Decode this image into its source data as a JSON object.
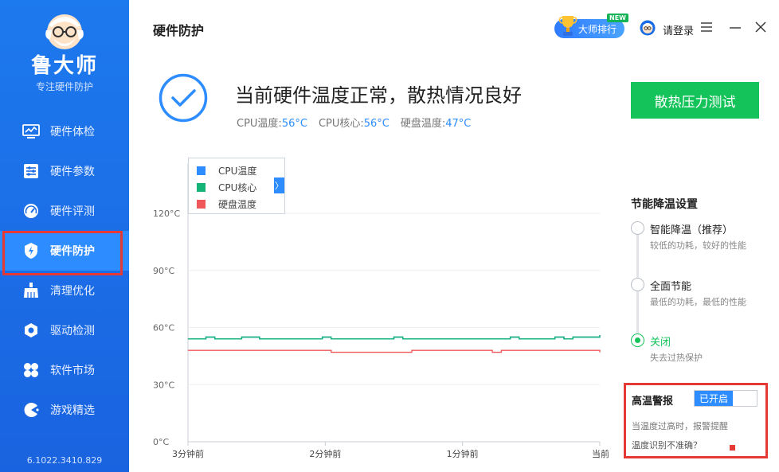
{
  "sidebar": {
    "brand": "鲁大师",
    "subtitle": "专注硬件防护",
    "items": [
      {
        "label": "硬件体检",
        "icon": "monitor-icon"
      },
      {
        "label": "硬件参数",
        "icon": "sliders-icon"
      },
      {
        "label": "硬件评测",
        "icon": "gauge-icon"
      },
      {
        "label": "硬件防护",
        "icon": "shield-bolt-icon",
        "active": true
      },
      {
        "label": "清理优化",
        "icon": "broom-icon"
      },
      {
        "label": "驱动检测",
        "icon": "gear-hex-icon"
      },
      {
        "label": "软件市场",
        "icon": "apps-icon"
      },
      {
        "label": "游戏精选",
        "icon": "pacman-icon"
      }
    ],
    "version": "6.1022.3410.829"
  },
  "header": {
    "title": "硬件防护",
    "rank_label": "大师排行",
    "new_badge": "NEW",
    "login_label": "请登录"
  },
  "status": {
    "title": "当前硬件温度正常，散热情况良好",
    "cpu_temp_label": "CPU温度:",
    "cpu_temp_value": "56°C",
    "cpu_core_label": "CPU核心:",
    "cpu_core_value": "56°C",
    "disk_temp_label": "硬盘温度:",
    "disk_temp_value": "47°C",
    "stress_button": "散热压力测试"
  },
  "chart_legend": {
    "toggle": "〉"
  },
  "chart_data": {
    "type": "line",
    "x": [
      "3分钟前",
      "2分钟前",
      "1分钟前",
      "当前"
    ],
    "yticks": [
      "120°C",
      "90°C",
      "60°C",
      "30°C",
      "0°C"
    ],
    "ylim": [
      0,
      120
    ],
    "legend_placement": "top-left",
    "series": [
      {
        "name": "CPU温度",
        "color": "#2d8cff",
        "values": [
          54,
          54,
          55,
          54,
          54,
          54,
          55,
          55,
          54,
          54,
          54,
          54,
          54,
          54,
          54,
          55,
          54,
          54,
          54,
          54,
          54,
          54,
          54,
          55,
          54,
          54,
          54,
          54,
          54,
          54,
          54,
          54,
          54,
          54,
          54,
          54,
          55,
          54,
          54,
          54,
          54,
          55,
          54,
          55,
          55,
          55,
          56
        ]
      },
      {
        "name": "CPU核心",
        "color": "#14b377",
        "values": [
          54,
          54,
          55,
          54,
          54,
          54,
          55,
          55,
          54,
          54,
          54,
          54,
          54,
          54,
          54,
          55,
          54,
          54,
          54,
          54,
          54,
          54,
          54,
          55,
          54,
          54,
          54,
          54,
          54,
          54,
          54,
          54,
          54,
          54,
          54,
          54,
          55,
          54,
          54,
          54,
          54,
          55,
          54,
          55,
          55,
          55,
          56
        ]
      },
      {
        "name": "硬盘温度",
        "color": "#f0575a",
        "values": [
          48,
          48,
          48,
          48,
          48,
          48,
          48,
          48,
          48,
          48,
          48,
          48,
          48,
          48,
          48,
          48,
          47,
          47,
          47,
          47,
          47,
          47,
          47,
          47,
          47,
          48,
          48,
          48,
          48,
          48,
          48,
          48,
          48,
          48,
          47,
          48,
          48,
          48,
          48,
          48,
          48,
          48,
          48,
          48,
          48,
          48,
          47
        ]
      }
    ]
  },
  "settings": {
    "title": "节能降温设置",
    "options": [
      {
        "label": "智能降温（推荐）",
        "desc": "较低的功耗，较好的性能",
        "selected": false
      },
      {
        "label": "全面节能",
        "desc": "最低的功耗，最低的性能",
        "selected": false
      },
      {
        "label": "关闭",
        "desc": "失去过热保护",
        "selected": true
      }
    ]
  },
  "alarm": {
    "title": "高温警报",
    "toggle_on": "已开启",
    "desc": "当温度过高时，报警提醒",
    "link": "温度识别不准确？"
  },
  "colors": {
    "sidebar": "#1d6fe8",
    "accent": "#2d8cff",
    "green": "#14c35a",
    "highlight": "#e53935"
  }
}
